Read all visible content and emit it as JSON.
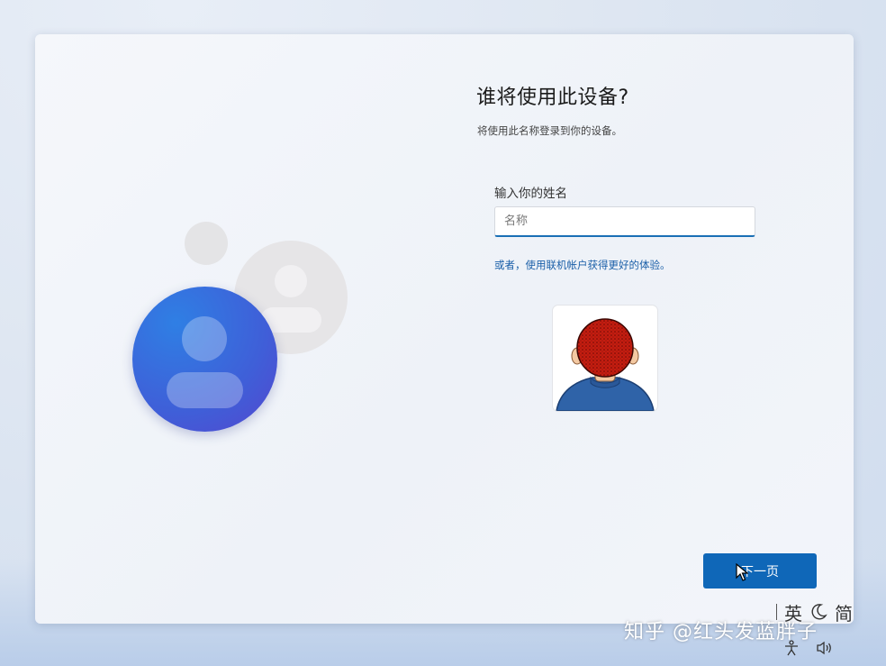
{
  "setup": {
    "title": "谁将使用此设备?",
    "subtitle": "将使用此名称登录到你的设备。",
    "name_label": "输入你的姓名",
    "name_placeholder": "名称",
    "name_value": "",
    "online_account_link": "或者，使用联机帐户获得更好的体验。",
    "next_button": "下一页"
  },
  "tray": {
    "ime_language": "英",
    "ime_script": "简",
    "ime_mode_icon": "moon-icon",
    "accessibility_icon": "accessibility-icon",
    "volume_icon": "volume-icon"
  },
  "watermark": "知乎 @红头发蓝胖子",
  "colors": {
    "accent": "#0f67b8",
    "link": "#1a5fa8",
    "avatar_gradient_start": "#2f7fe4",
    "avatar_gradient_end": "#5446cf"
  }
}
